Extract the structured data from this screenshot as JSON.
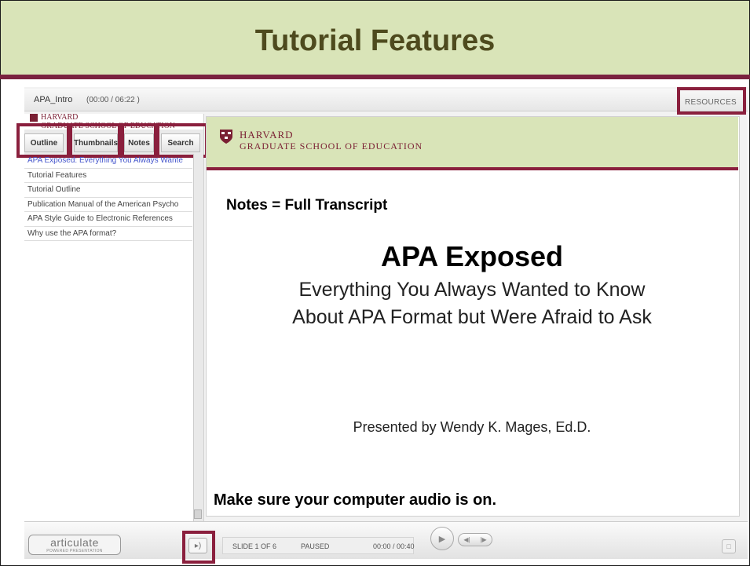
{
  "slide_title": "Tutorial Features",
  "player": {
    "project_title": "APA_Intro",
    "project_time": "(00:00 / 06:22 )",
    "resources_label": "RESOURCES"
  },
  "sidebar": {
    "logo_line1": "HARVARD",
    "logo_line2": "GRADUATE SCHOOL OF EDUCATION",
    "tabs": [
      {
        "label": "Outline"
      },
      {
        "label": "Thumbnails"
      },
      {
        "label": "Notes"
      },
      {
        "label": "Search"
      }
    ],
    "outline_items": [
      {
        "label": "APA Exposed: Everything You Always Wante",
        "active": true
      },
      {
        "label": "Tutorial Features"
      },
      {
        "label": "Tutorial Outline"
      },
      {
        "label": "Publication Manual of the American Psycho"
      },
      {
        "label": "APA Style Guide to Electronic References"
      },
      {
        "label": "Why use the APA format?"
      }
    ]
  },
  "slide": {
    "header_line1": "HARVARD",
    "header_line2": "GRADUATE SCHOOL OF EDUCATION",
    "notes_callout": "Notes = Full Transcript",
    "title": "APA Exposed",
    "subtitle_line1": "Everything You Always Wanted to Know",
    "subtitle_line2": "About APA Format but Were Afraid to Ask",
    "presenter": "Presented by Wendy K. Mages, Ed.D.",
    "audio_note": "Make sure your computer audio is on."
  },
  "controls": {
    "brand_word": "articulate",
    "brand_sub": "POWERED PRESENTATION",
    "volume_icon": "speaker-icon",
    "slide_counter": "SLIDE 1 OF 6",
    "state": "PAUSED",
    "time": "00:00 / 00:40",
    "play_icon": "play-icon",
    "fullscreen_icon": "fullscreen-icon"
  },
  "colors": {
    "title_bg": "#d9e4b8",
    "title_text": "#4e4a1e",
    "accent": "#8a1f3d"
  }
}
